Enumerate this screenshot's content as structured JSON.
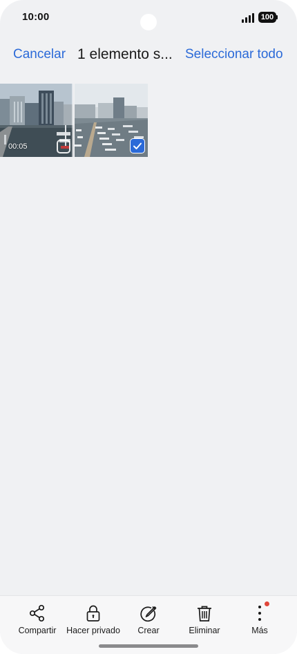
{
  "status_bar": {
    "time": "10:00",
    "battery": "100"
  },
  "header": {
    "cancel_label": "Cancelar",
    "title": "1 elemento s...",
    "select_all_label": "Seleccionar todo"
  },
  "thumbnails": [
    {
      "duration": "00:05",
      "selected": false
    },
    {
      "selected": true
    }
  ],
  "toolbar": {
    "items": [
      {
        "label": "Compartir",
        "icon": "share-icon"
      },
      {
        "label": "Hacer privado",
        "icon": "lock-icon"
      },
      {
        "label": "Crear",
        "icon": "pen-icon"
      },
      {
        "label": "Eliminar",
        "icon": "trash-icon"
      },
      {
        "label": "Más",
        "icon": "more-vertical-icon"
      }
    ]
  },
  "colors": {
    "accent": "#2b6ad8",
    "background": "#f0f1f3",
    "badge": "#e0463a"
  }
}
